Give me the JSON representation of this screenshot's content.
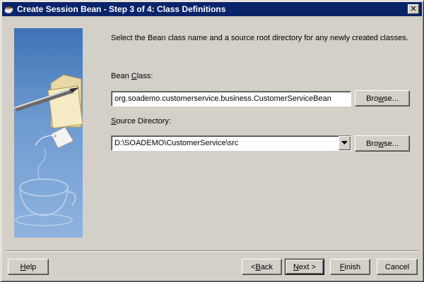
{
  "window": {
    "title": "Create Session Bean - Step 3 of 4: Class Definitions",
    "close_glyph": "✕"
  },
  "instruction": "Select the Bean class name and a source root directory for any newly created classes.",
  "bean_class": {
    "label_pre": "Bean ",
    "label_mnemonic": "C",
    "label_post": "lass:",
    "value": "org.soademo.customerservice.business.CustomerServiceBean",
    "browse_mnemonic": "w",
    "browse_pre": "Bro",
    "browse_post": "se..."
  },
  "source_directory": {
    "label_mnemonic": "S",
    "label_post": "ource Directory:",
    "value": "D:\\SOADEMO\\CustomerService\\src",
    "browse_pre": "Bro",
    "browse_mnemonic": "w",
    "browse_post": "se..."
  },
  "buttons": {
    "help_mnemonic": "H",
    "help_post": "elp",
    "back_pre": "< ",
    "back_mnemonic": "B",
    "back_post": "ack",
    "next_mnemonic": "N",
    "next_post": "ext >",
    "finish_mnemonic": "F",
    "finish_post": "inish",
    "cancel": "Cancel"
  }
}
